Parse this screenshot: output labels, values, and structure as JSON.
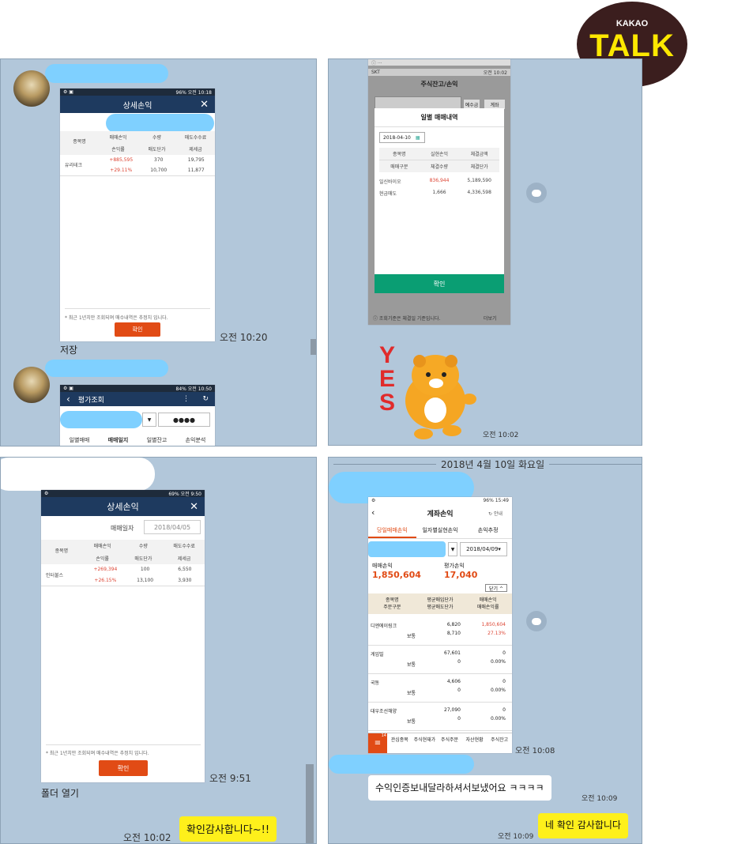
{
  "kakao": {
    "small": "KAKAO",
    "big": "TALK"
  },
  "panel1": {
    "shot1": {
      "status_right": "96% 오전 10:18",
      "title": "상세손익",
      "close": "✕",
      "col1": "종목명",
      "col2a": "매매손익",
      "col2b": "손익률",
      "col3a": "수량",
      "col3b": "매도단가",
      "col4a": "매도수수료",
      "col4b": "제세금",
      "stock": "유리테크",
      "pnl": "+885,595",
      "rate": "+29.11%",
      "qty": "370",
      "price": "10,700",
      "fee": "19,795",
      "tax": "11,877",
      "note": "* 최근 1년치만 조회되며 매수내역은 추정치 입니다.",
      "ok": "확인"
    },
    "time1": "오전 10:20",
    "text1": "저장",
    "shot2": {
      "status_right": "84% 오전 10:50",
      "title": "평가조회",
      "back": "‹",
      "password": "●●●●",
      "tabs": [
        "일별매매",
        "매매일지",
        "일별잔고",
        "손익분석"
      ]
    }
  },
  "panel2": {
    "status_left": "SKT",
    "status_right": "오전 10:02",
    "app_title": "주식잔고/손익",
    "side_btn1": "예수금",
    "side_btn2": "계좌",
    "modal_title": "일별 매매내역",
    "date": "2018-04-10",
    "h1": "종목명",
    "h2": "실현손익",
    "h3": "체결금액",
    "h4": "매매구분",
    "h5": "체결수량",
    "h6": "체결단가",
    "row1": [
      "일신바이오",
      "836,944",
      "5,189,590"
    ],
    "row2": [
      "현금매도",
      "1,666",
      "4,336,598"
    ],
    "ok": "확인",
    "bottom_note": "ⓘ 조회기준은 체결일 기준입니다.",
    "bottom_right": "더보기",
    "sticker_text": "YES",
    "time": "오전 10:02"
  },
  "panel3": {
    "status_right": "69% 오전 9:50",
    "title": "상세손익",
    "close": "✕",
    "date_label": "매매일자",
    "date": "2018/04/05",
    "col1": "종목명",
    "col2a": "매매손익",
    "col2b": "손익률",
    "col3a": "수량",
    "col3b": "매도단가",
    "col4a": "매도수수료",
    "col4b": "제세금",
    "stock": "인터불스",
    "pnl": "+269,394",
    "rate": "+26.15%",
    "qty": "100",
    "price": "13,100",
    "fee": "6,550",
    "tax": "3,930",
    "note": "* 최근 1년치만 조회되며 매수내역은 추정치 입니다.",
    "ok": "확인",
    "time1": "오전 9:51",
    "text1": "폴더 열기",
    "time2": "오전 10:02",
    "bubble": "확인감사합니다~!!"
  },
  "panel4": {
    "date_divider": "2018년 4월 10일 화요일",
    "status_right": "96% 15:49",
    "title": "계좌손익",
    "guide": "안내",
    "tabs": [
      "당일매매손익",
      "일자별실현손익",
      "손익추정"
    ],
    "date": "2018/04/09",
    "pnl_label": "매매손익",
    "pnl_value": "1,850,604",
    "eval_label": "평가손익",
    "eval_value": "17,040",
    "close_btn": "닫기",
    "head": [
      "종목명",
      "주문구분",
      "평균매입단가",
      "평균매도단가",
      "매매손익",
      "매매손익률"
    ],
    "rows": [
      {
        "name": "디엔에이링크",
        "type": "보통",
        "buy": "6,820",
        "sell": "8,710",
        "pnl": "1,850,604",
        "rate": "27.13%",
        "red": true
      },
      {
        "name": "게임빌",
        "type": "보통",
        "buy": "67,601",
        "sell": "0",
        "pnl": "0",
        "rate": "0.00%",
        "red": false
      },
      {
        "name": "국동",
        "type": "보통",
        "buy": "4,606",
        "sell": "0",
        "pnl": "0",
        "rate": "0.00%",
        "red": false
      },
      {
        "name": "대우조선해양",
        "type": "보통",
        "buy": "27,090",
        "sell": "0",
        "pnl": "0",
        "rate": "0.00%",
        "red": false
      }
    ],
    "bottom_tabs": [
      "관심종목",
      "주식현재가",
      "주식주문",
      "자산현황",
      "주식잔고"
    ],
    "menu_badge": "14",
    "time1": "오전 10:08",
    "bubble_white": "수익인증보내달라하셔서보냈어요 ㅋㅋㅋㅋ",
    "time2": "오전 10:09",
    "time3": "오전 10:09",
    "bubble_yellow": "네 확인 감사합니다"
  }
}
